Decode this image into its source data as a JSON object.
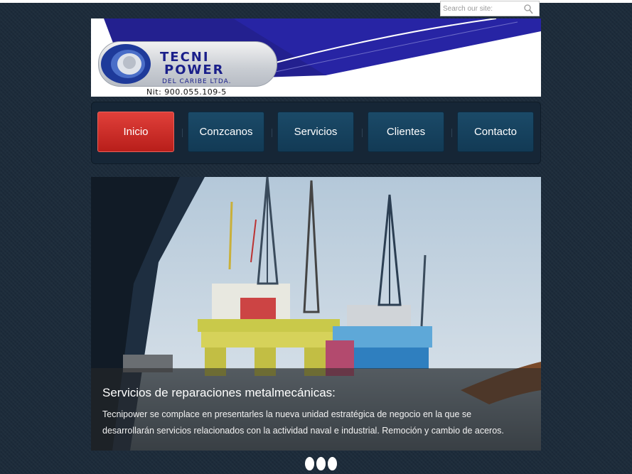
{
  "search": {
    "placeholder": "Search our site:",
    "icon": "search-icon"
  },
  "logo": {
    "line1": "TECNI",
    "line2": "POWER",
    "sub": "DEL CARIBE LTDA.",
    "nit": "Nit: 900.055.109-5"
  },
  "nav": {
    "items": [
      {
        "label": "Inicio"
      },
      {
        "label": "Conzcanos"
      },
      {
        "label": "Servicios"
      },
      {
        "label": "Clientes"
      },
      {
        "label": "Contacto"
      }
    ],
    "active_color": "#c8302b",
    "button_color": "#153f5c"
  },
  "slide": {
    "title": "Servicios de reparaciones metalmecánicas:",
    "text": "Tecnipower se complace en presentarles la nueva unidad estratégica de negocio en la que se desarrollarán servicios relacionados con la actividad naval e industrial. Remoción y cambio de aceros."
  },
  "pager": {
    "count": 3
  },
  "colors": {
    "background": "#1c2b3a",
    "brand_blue": "#1a1f8a"
  }
}
